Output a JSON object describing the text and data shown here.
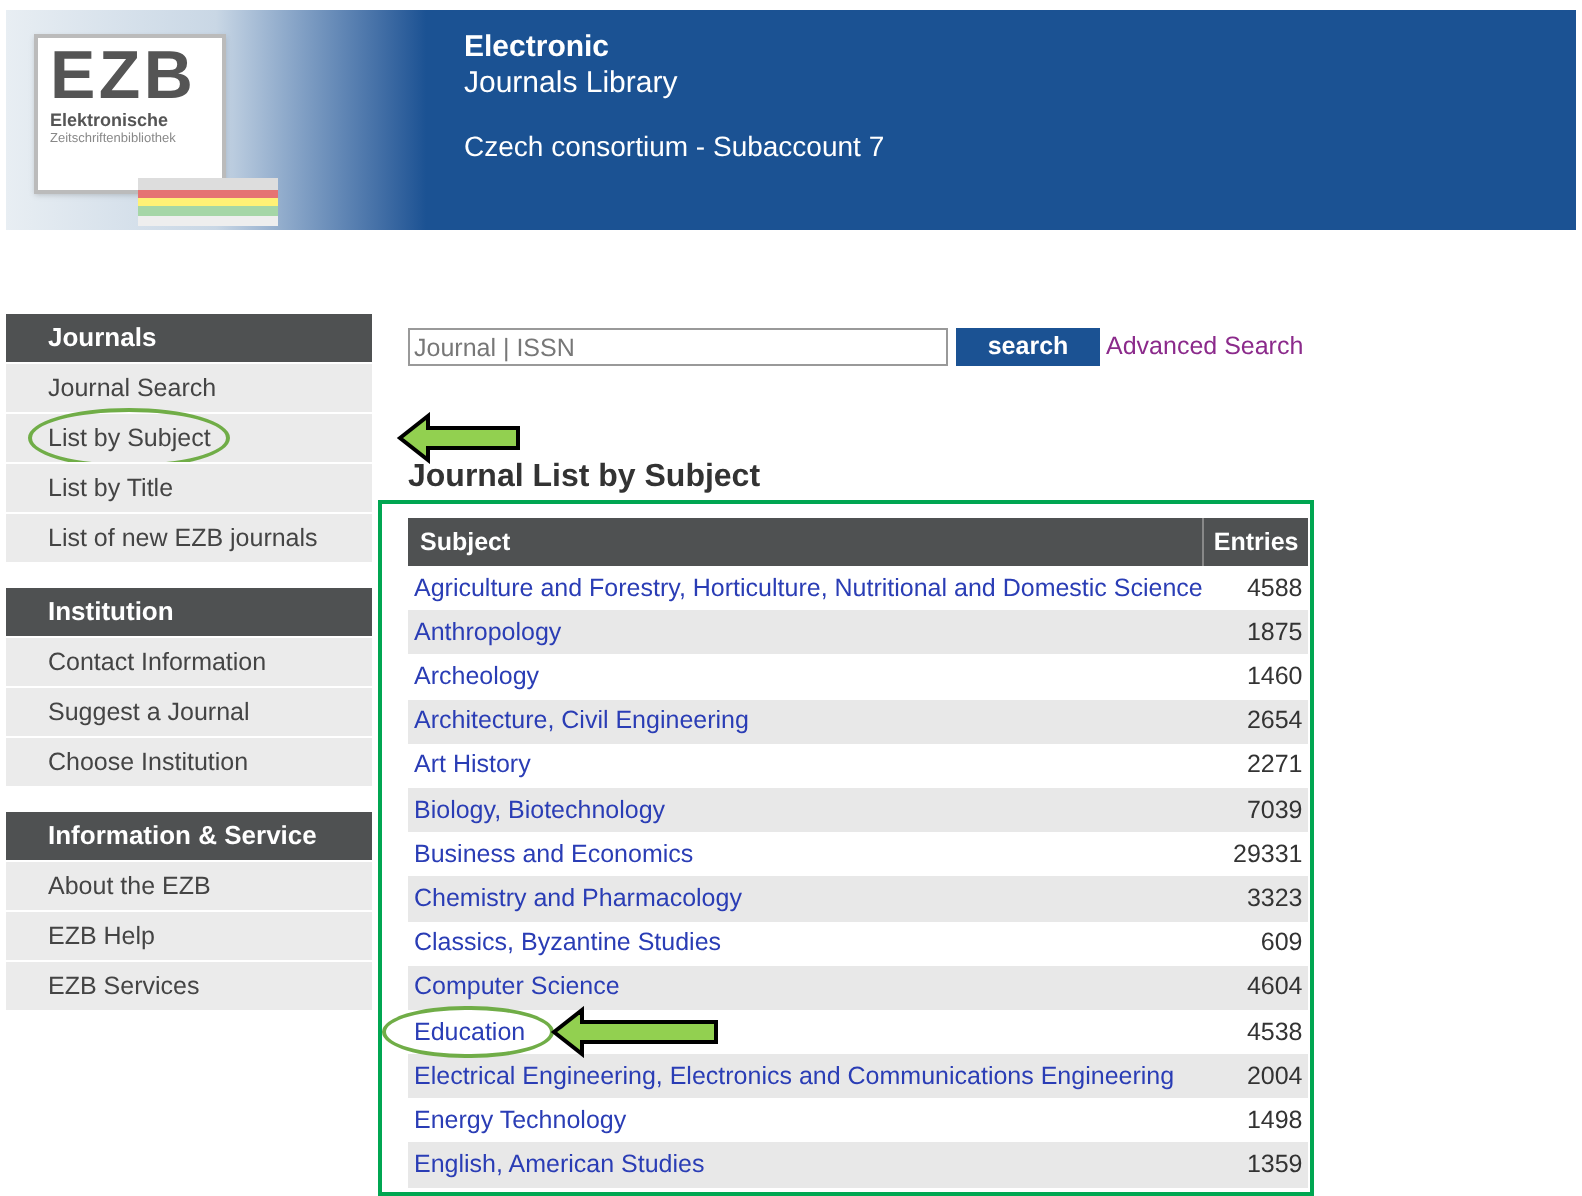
{
  "header": {
    "logo": {
      "mark": "EZB",
      "line1": "Elektronische",
      "line2": "Zeitschriftenbibliothek"
    },
    "title": "Electronic",
    "subtitle": "Journals Library",
    "account": "Czech consortium - Subaccount 7"
  },
  "sidebar": [
    {
      "heading": "Journals",
      "items": [
        {
          "label": "Journal Search",
          "highlighted": false
        },
        {
          "label": "List by Subject",
          "highlighted": true
        },
        {
          "label": "List by Title",
          "highlighted": false
        },
        {
          "label": "List of new EZB journals",
          "highlighted": false
        }
      ]
    },
    {
      "heading": "Institution",
      "items": [
        {
          "label": "Contact Information",
          "highlighted": false
        },
        {
          "label": "Suggest a Journal",
          "highlighted": false
        },
        {
          "label": "Choose Institution",
          "highlighted": false
        }
      ]
    },
    {
      "heading": "Information & Service",
      "items": [
        {
          "label": "About the EZB",
          "highlighted": false
        },
        {
          "label": "EZB Help",
          "highlighted": false
        },
        {
          "label": "EZB Services",
          "highlighted": false
        }
      ]
    }
  ],
  "search": {
    "placeholder": "Journal | ISSN",
    "button": "search",
    "advanced": "Advanced Search"
  },
  "heading": "Journal List by Subject",
  "table": {
    "columns": [
      "Subject",
      "Entries"
    ],
    "rows": [
      {
        "subject": "Agriculture and Forestry, Horticulture, Nutritional and Domestic Science",
        "entries": "4588",
        "highlighted": false
      },
      {
        "subject": "Anthropology",
        "entries": "1875",
        "highlighted": false
      },
      {
        "subject": "Archeology",
        "entries": "1460",
        "highlighted": false
      },
      {
        "subject": "Architecture, Civil Engineering",
        "entries": "2654",
        "highlighted": false
      },
      {
        "subject": "Art History",
        "entries": "2271",
        "highlighted": false
      },
      {
        "subject": "Biology, Biotechnology",
        "entries": "7039",
        "highlighted": false
      },
      {
        "subject": "Business and Economics",
        "entries": "29331",
        "highlighted": false
      },
      {
        "subject": "Chemistry and Pharmacology",
        "entries": "3323",
        "highlighted": false
      },
      {
        "subject": "Classics, Byzantine Studies",
        "entries": "609",
        "highlighted": false
      },
      {
        "subject": "Computer Science",
        "entries": "4604",
        "highlighted": false
      },
      {
        "subject": "Education",
        "entries": "4538",
        "highlighted": true
      },
      {
        "subject": "Electrical Engineering, Electronics and Communications Engineering",
        "entries": "2004",
        "highlighted": false
      },
      {
        "subject": "Energy Technology",
        "entries": "1498",
        "highlighted": false
      },
      {
        "subject": "English, American Studies",
        "entries": "1359",
        "highlighted": false
      }
    ]
  }
}
